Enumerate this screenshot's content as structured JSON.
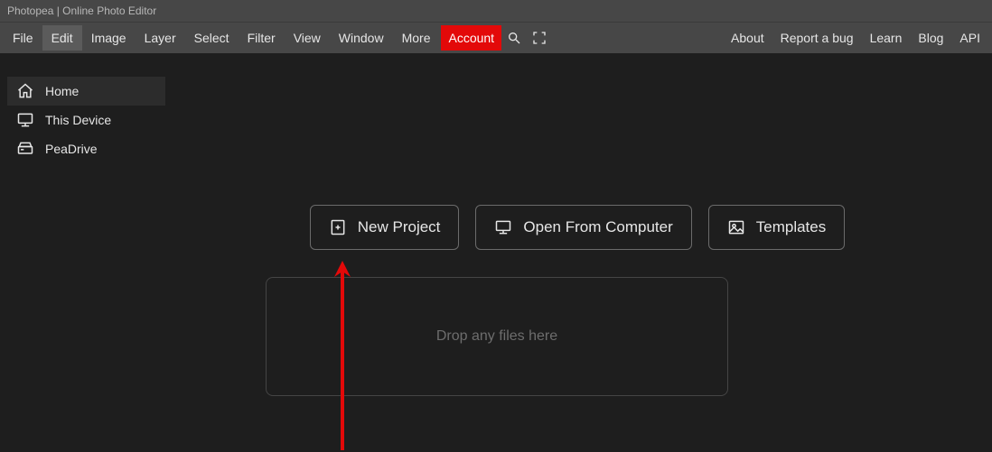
{
  "title": "Photopea | Online Photo Editor",
  "menu": {
    "file": "File",
    "edit": "Edit",
    "image": "Image",
    "layer": "Layer",
    "select": "Select",
    "filter": "Filter",
    "view": "View",
    "window": "Window",
    "more": "More",
    "account": "Account"
  },
  "links": {
    "about": "About",
    "report": "Report a bug",
    "learn": "Learn",
    "blog": "Blog",
    "api": "API"
  },
  "sidebar": {
    "home": "Home",
    "device": "This Device",
    "peadrive": "PeaDrive"
  },
  "buttons": {
    "new_project": "New Project",
    "open_computer": "Open From Computer",
    "templates": "Templates"
  },
  "dropzone_text": "Drop any files here"
}
